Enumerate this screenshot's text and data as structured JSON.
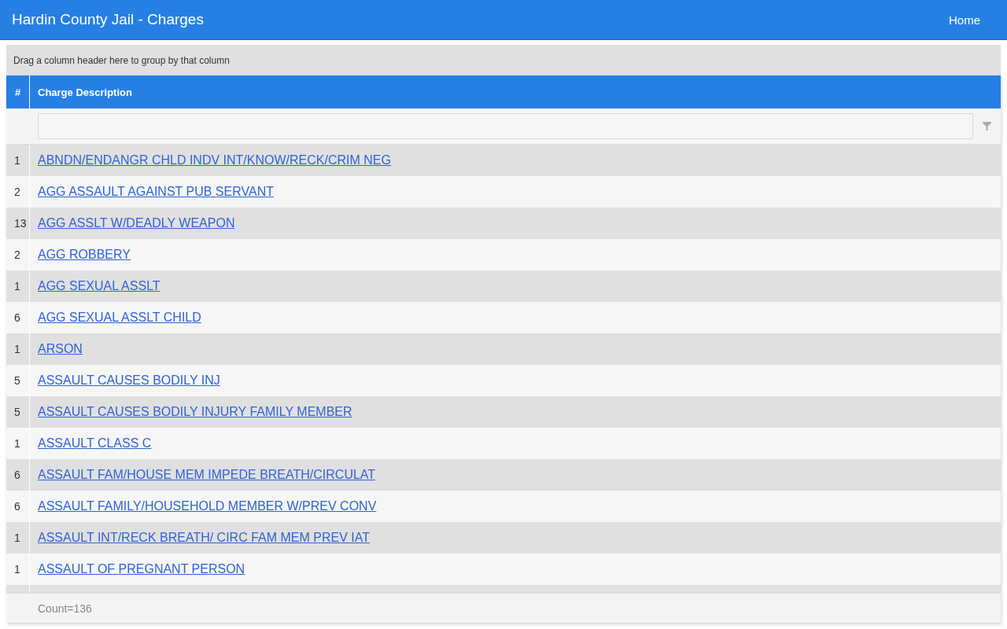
{
  "header": {
    "title": "Hardin County Jail - Charges",
    "nav": [
      {
        "label": "Home"
      }
    ]
  },
  "group_panel": {
    "hint": "Drag a column header here to group by that column"
  },
  "grid": {
    "columns": [
      {
        "label": "#"
      },
      {
        "label": "Charge Description"
      }
    ],
    "rows": [
      {
        "count": "1",
        "charge": "ABNDN/ENDANGR CHLD INDV INT/KNOW/RECK/CRIM NEG"
      },
      {
        "count": "2",
        "charge": "AGG ASSAULT AGAINST PUB SERVANT"
      },
      {
        "count": "13",
        "charge": "AGG ASSLT W/DEADLY WEAPON"
      },
      {
        "count": "2",
        "charge": "AGG ROBBERY"
      },
      {
        "count": "1",
        "charge": "AGG SEXUAL ASSLT"
      },
      {
        "count": "6",
        "charge": "AGG SEXUAL ASSLT CHILD"
      },
      {
        "count": "1",
        "charge": "ARSON"
      },
      {
        "count": "5",
        "charge": "ASSAULT CAUSES BODILY INJ"
      },
      {
        "count": "5",
        "charge": "ASSAULT CAUSES BODILY INJURY FAMILY MEMBER"
      },
      {
        "count": "1",
        "charge": "ASSAULT CLASS C"
      },
      {
        "count": "6",
        "charge": "ASSAULT FAM/HOUSE MEM IMPEDE BREATH/CIRCULAT"
      },
      {
        "count": "6",
        "charge": "ASSAULT FAMILY/HOUSEHOLD MEMBER W/PREV CONV"
      },
      {
        "count": "1",
        "charge": "ASSAULT INT/RECK BREATH/ CIRC FAM MEM PREV IAT"
      },
      {
        "count": "1",
        "charge": "ASSAULT OF PREGNANT PERSON"
      }
    ],
    "footer": {
      "summary": "Count=136"
    }
  }
}
